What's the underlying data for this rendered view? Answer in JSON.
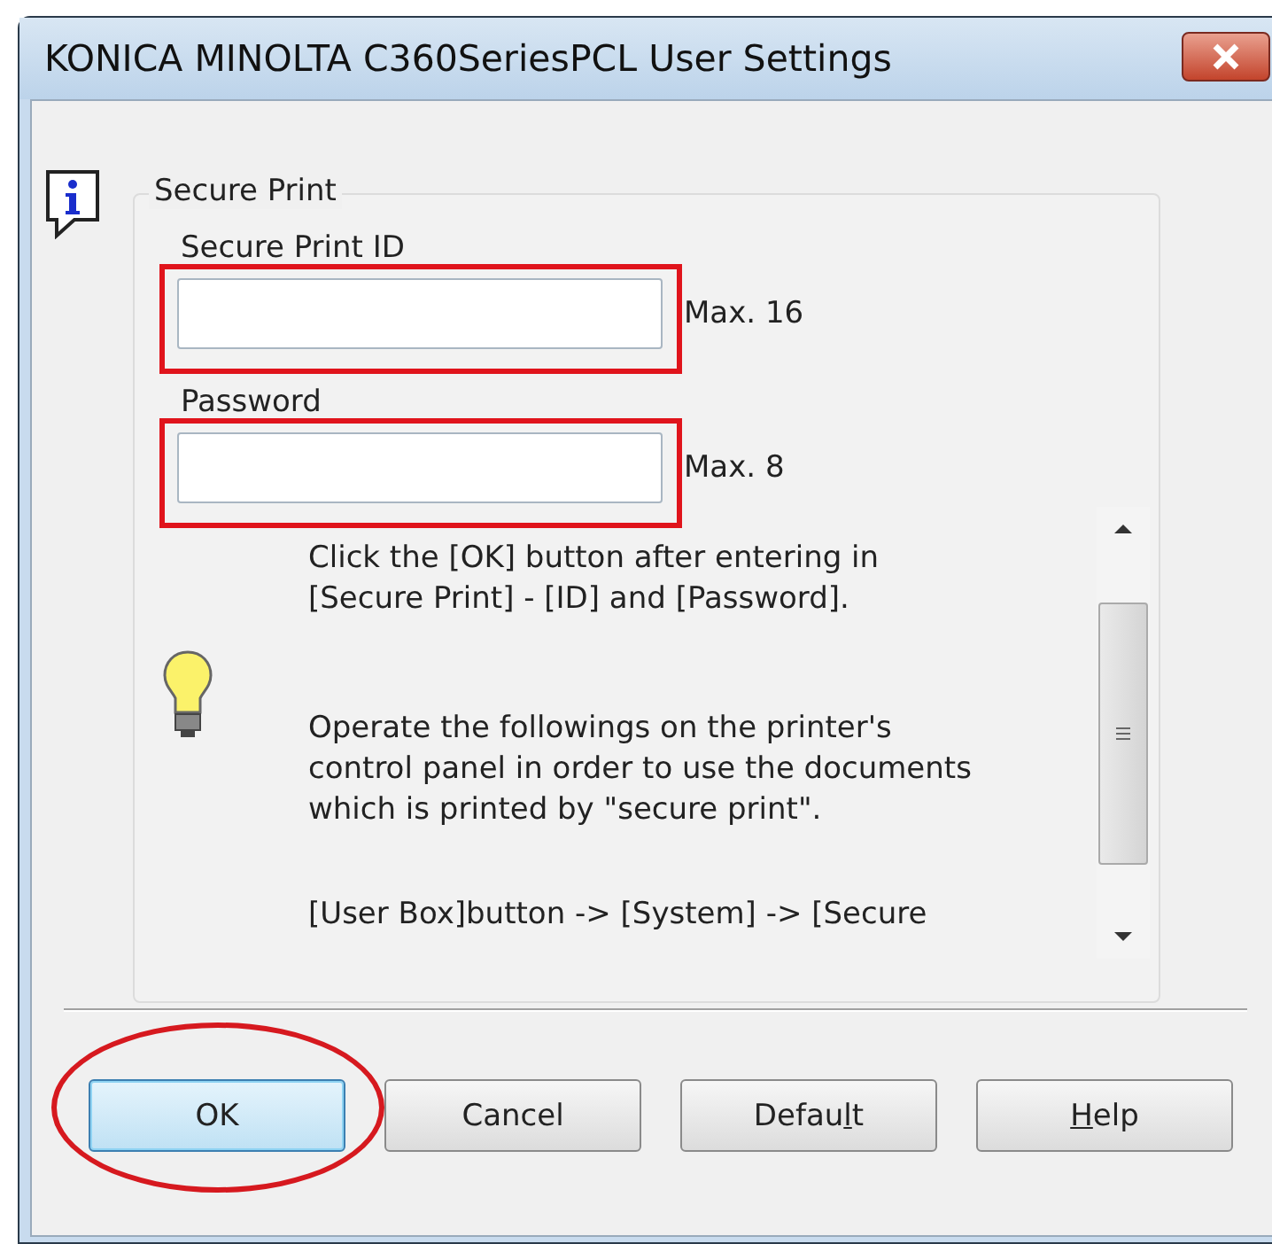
{
  "window": {
    "title": "KONICA MINOLTA C360SeriesPCL User Settings"
  },
  "group": {
    "title": "Secure Print",
    "fields": [
      {
        "label": "Secure Print ID",
        "hint": "Max. 16",
        "highlighted": true
      },
      {
        "label": "Password",
        "hint": "Max. 8",
        "highlighted": true
      }
    ],
    "help_text": [
      "Click the [OK] button after entering in\n[Secure Print] - [ID] and [Password].",
      "Operate the followings on the printer's\ncontrol panel in order to use the documents\nwhich is printed by \"secure print\".",
      "[User Box]button -> [System] -> [Secure"
    ]
  },
  "buttons": [
    {
      "label": [
        {
          "text": "OK",
          "underlined": false
        }
      ],
      "default": true,
      "highlighted": true
    },
    {
      "label": [
        {
          "text": "Cancel",
          "underlined": false
        }
      ],
      "default": false,
      "highlighted": false
    },
    {
      "label": [
        {
          "text": "Defau",
          "underlined": false
        },
        {
          "text": "l",
          "underlined": true
        },
        {
          "text": "t",
          "underlined": false
        }
      ],
      "default": false,
      "highlighted": false
    },
    {
      "label": [
        {
          "text": "H",
          "underlined": true
        },
        {
          "text": "elp",
          "underlined": false
        }
      ],
      "default": false,
      "highlighted": false
    }
  ]
}
